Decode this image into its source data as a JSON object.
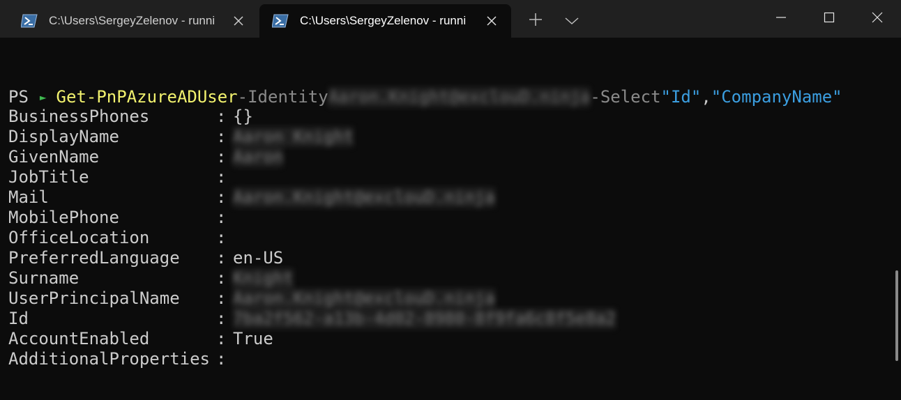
{
  "tabs": [
    {
      "title": "C:\\Users\\SergeyZelenov  - runni",
      "active": false
    },
    {
      "title": "C:\\Users\\SergeyZelenov  - runni",
      "active": true
    }
  ],
  "icons": {
    "tab_icon": "powershell-icon",
    "tab_close": "close-icon",
    "new_tab": "plus-icon",
    "dropdown": "chevron-down-icon",
    "minimize": "minimize-icon",
    "maximize": "maximize-icon",
    "close": "close-icon"
  },
  "colors": {
    "background": "#0c0c0c",
    "cmdlet": "#f2f26e",
    "string": "#3b9ee0",
    "prompt_arrow": "#3fb950"
  },
  "prompt": {
    "ps": "PS",
    "arrow": "►",
    "cmdlet": "Get-PnPAzureADUser",
    "param1": "-Identity",
    "identity_value": "Aaron.Knight@exclouD.ninja",
    "param2": "-Select",
    "arg1": "\"Id\"",
    "comma": ",",
    "arg2": "\"CompanyName\""
  },
  "properties": [
    {
      "name": "BusinessPhones",
      "value": "{}",
      "blurred": false
    },
    {
      "name": "DisplayName",
      "value": "Aaron Knight",
      "blurred": true
    },
    {
      "name": "GivenName",
      "value": "Aaron",
      "blurred": true
    },
    {
      "name": "JobTitle",
      "value": "",
      "blurred": false
    },
    {
      "name": "Mail",
      "value": "Aaron.Knight@exclouD.ninja",
      "blurred": true
    },
    {
      "name": "MobilePhone",
      "value": "",
      "blurred": false
    },
    {
      "name": "OfficeLocation",
      "value": "",
      "blurred": false
    },
    {
      "name": "PreferredLanguage",
      "value": "en-US",
      "blurred": false
    },
    {
      "name": "Surname",
      "value": "Knight",
      "blurred": true
    },
    {
      "name": "UserPrincipalName",
      "value": "Aaron.Knight@exclouD.ninja",
      "blurred": true
    },
    {
      "name": "Id",
      "value": "7ba2f562-a13b-4d02-8980-8f9fa6c8f5e8a2",
      "blurred": true
    },
    {
      "name": "AccountEnabled",
      "value": "True",
      "blurred": false
    },
    {
      "name": "AdditionalProperties",
      "value": "",
      "blurred": false
    }
  ],
  "separator": ":"
}
